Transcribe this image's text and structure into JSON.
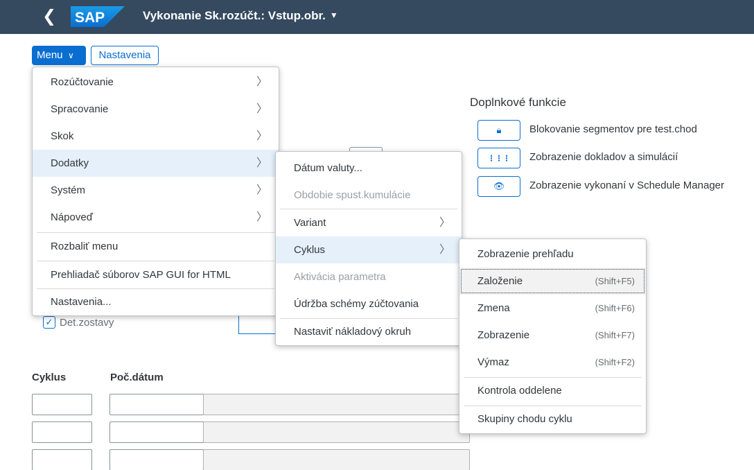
{
  "shell": {
    "back_glyph": "❮",
    "logo_text": "SAP",
    "title": "Vykonanie Sk.rozúčt.: Vstup.obr.",
    "title_caret": "▼"
  },
  "toolbar": {
    "menu_label": "Menu",
    "menu_chevron": "∨",
    "settings_label": "Nastavenia"
  },
  "functions": {
    "title": "Doplnkové funkcie",
    "items": [
      {
        "icon": "lock-icon",
        "glyph": "🔒︎",
        "label": "Blokovanie segmentov pre test.chod"
      },
      {
        "icon": "documents-icon",
        "glyph": "⋮⋮⋮",
        "label": "Zobrazenie dokladov a simulácií"
      },
      {
        "icon": "eye-icon",
        "glyph": "👁︎",
        "label": "Zobrazenie vykonaní v Schedule Manager"
      }
    ]
  },
  "form": {
    "checkbox_label": "Det.zostavy",
    "checkbox_mark": "✓",
    "columns": [
      "Cyklus",
      "Poč.dátum"
    ]
  },
  "main_menu": {
    "items": [
      {
        "label": "Rozúčtovanie",
        "arrow": "〉"
      },
      {
        "label": "Spracovanie",
        "arrow": "〉"
      },
      {
        "label": "Skok",
        "arrow": "〉"
      },
      {
        "label": "Dodatky",
        "arrow": "〉"
      },
      {
        "label": "Systém",
        "arrow": "〉"
      },
      {
        "label": "Nápoveď",
        "arrow": "〉"
      },
      {
        "label": "Rozbaliť menu"
      },
      {
        "label": "Prehliadač súborov SAP GUI for HTML"
      },
      {
        "label": "Nastavenia..."
      }
    ]
  },
  "dodatky_menu": {
    "items": [
      {
        "label": "Dátum valuty..."
      },
      {
        "label": "Obdobie spust.kumulácie"
      },
      {
        "label": "Variant",
        "arrow": "〉"
      },
      {
        "label": "Cyklus",
        "arrow": "〉"
      },
      {
        "label": "Aktivácia parametra"
      },
      {
        "label": "Údržba schémy zúčtovania"
      },
      {
        "label": "Nastaviť nákladový okruh"
      }
    ]
  },
  "cyklus_menu": {
    "items": [
      {
        "label": "Zobrazenie prehľadu"
      },
      {
        "label": "Založenie",
        "shortcut": "(Shift+F5)"
      },
      {
        "label": "Zmena",
        "shortcut": "(Shift+F6)"
      },
      {
        "label": "Zobrazenie",
        "shortcut": "(Shift+F7)"
      },
      {
        "label": "Výmaz",
        "shortcut": "(Shift+F2)"
      },
      {
        "label": "Kontrola oddelene"
      },
      {
        "label": "Skupiny chodu cyklu"
      }
    ]
  },
  "colors": {
    "shell": "#354a5f",
    "accent": "#0a6ed1",
    "highlight": "#e5f0fa"
  }
}
